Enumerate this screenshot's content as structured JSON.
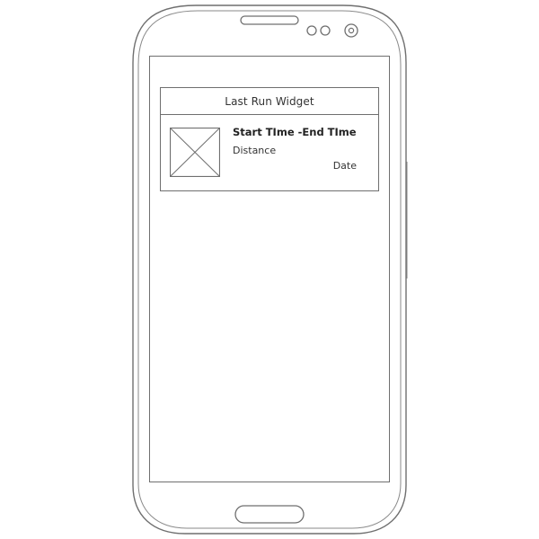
{
  "widget": {
    "title": "Last Run Widget",
    "time_range": "Start TIme -End TIme",
    "distance_label": "Distance",
    "date_label": "Date",
    "thumbnail_icon": "image-placeholder-icon"
  },
  "device": {
    "speaker_icon": "speaker-icon",
    "sensor_icons": [
      "sensor-dot-icon",
      "sensor-dot-icon"
    ],
    "camera_icon": "front-camera-icon",
    "home_button_icon": "home-button-icon",
    "outline_color": "#6f6f6f"
  }
}
